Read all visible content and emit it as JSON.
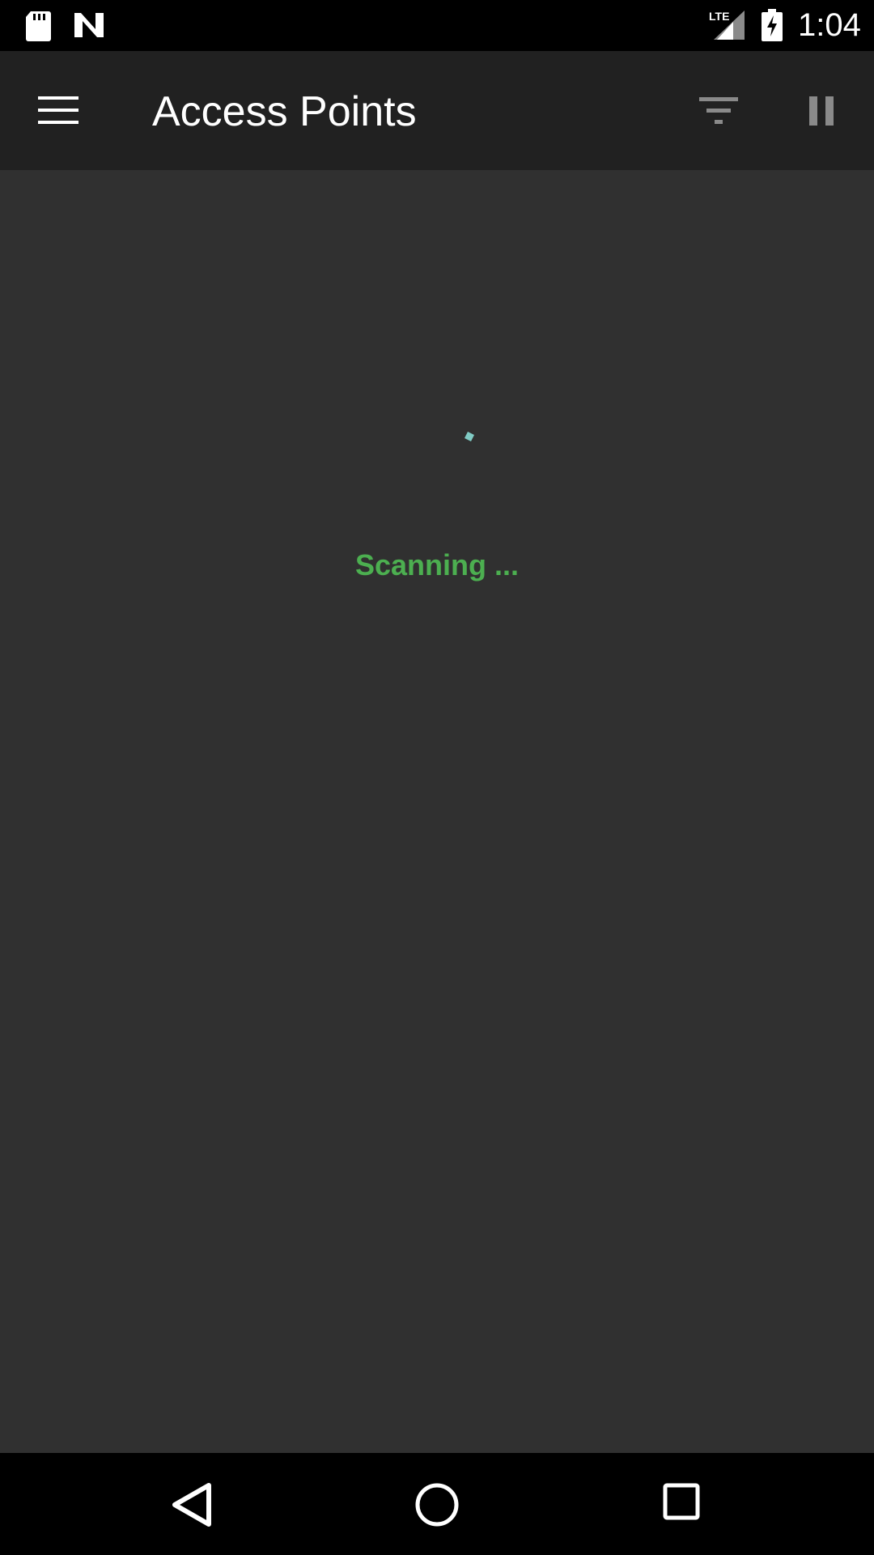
{
  "status_bar": {
    "time": "1:04",
    "network_label": "LTE",
    "icons": [
      "sd-card-icon",
      "n-notification-icon",
      "lte-signal-icon",
      "battery-charging-icon"
    ]
  },
  "app_bar": {
    "title": "Access Points",
    "menu_icon": "hamburger-menu-icon",
    "actions": [
      {
        "name": "filter",
        "icon": "filter-icon"
      },
      {
        "name": "pause",
        "icon": "pause-icon"
      }
    ]
  },
  "content": {
    "status_text": "Scanning ...",
    "status_color": "#4caf50",
    "spinner_color": "#80cbc4"
  },
  "nav_bar": {
    "buttons": [
      {
        "name": "back",
        "icon": "back-triangle-icon"
      },
      {
        "name": "home",
        "icon": "home-circle-icon"
      },
      {
        "name": "recents",
        "icon": "recents-square-icon"
      }
    ]
  },
  "colors": {
    "status_bar_bg": "#000000",
    "app_bar_bg": "#212121",
    "content_bg": "#303030",
    "nav_bar_bg": "#000000"
  }
}
